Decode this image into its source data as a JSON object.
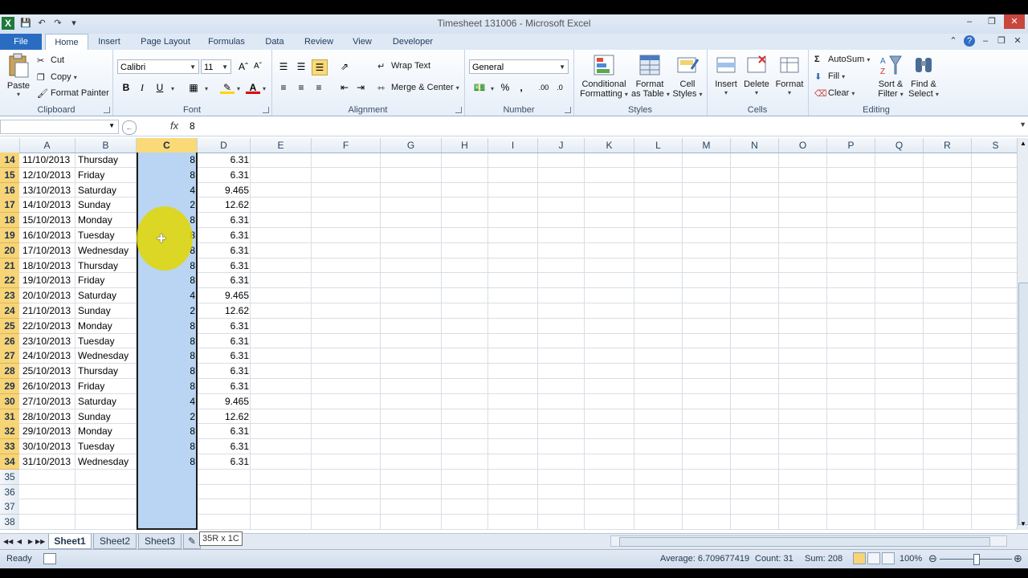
{
  "window": {
    "title": "Timesheet 131006 - Microsoft Excel"
  },
  "ribbon_tabs": [
    "File",
    "Home",
    "Insert",
    "Page Layout",
    "Formulas",
    "Data",
    "Review",
    "View",
    "Developer"
  ],
  "clipboard": {
    "paste": "Paste",
    "cut": "Cut",
    "copy": "Copy",
    "format_painter": "Format Painter",
    "label": "Clipboard"
  },
  "font": {
    "name": "Calibri",
    "size": "11",
    "bold": "B",
    "italic": "I",
    "underline": "U",
    "label": "Font"
  },
  "alignment": {
    "wrap_text": "Wrap Text",
    "merge_center": "Merge & Center",
    "label": "Alignment"
  },
  "number": {
    "format": "General",
    "percent": "%",
    "comma": ",",
    "label": "Number"
  },
  "styles": {
    "conditional_1": "Conditional",
    "conditional_2": "Formatting",
    "format_table_1": "Format",
    "format_table_2": "as Table",
    "cell_styles_1": "Cell",
    "cell_styles_2": "Styles",
    "label": "Styles"
  },
  "cells": {
    "insert": "Insert",
    "delete": "Delete",
    "format": "Format",
    "label": "Cells"
  },
  "editing": {
    "autosum": "AutoSum",
    "fill": "Fill",
    "clear": "Clear",
    "sort_1": "Sort &",
    "sort_2": "Filter",
    "find_1": "Find &",
    "find_2": "Select",
    "label": "Editing"
  },
  "formula_bar": {
    "name_box": "",
    "fx": "fx",
    "value": "8"
  },
  "columns": [
    "A",
    "B",
    "C",
    "D",
    "E",
    "F",
    "G",
    "H",
    "I",
    "J",
    "K",
    "L",
    "M",
    "N",
    "O",
    "P",
    "Q",
    "R",
    "S"
  ],
  "rows": [
    {
      "n": "14",
      "a": "11/10/2013",
      "b": "Thursday",
      "c": "8",
      "d": "6.31"
    },
    {
      "n": "15",
      "a": "12/10/2013",
      "b": "Friday",
      "c": "8",
      "d": "6.31"
    },
    {
      "n": "16",
      "a": "13/10/2013",
      "b": "Saturday",
      "c": "4",
      "d": "9.465"
    },
    {
      "n": "17",
      "a": "14/10/2013",
      "b": "Sunday",
      "c": "2",
      "d": "12.62"
    },
    {
      "n": "18",
      "a": "15/10/2013",
      "b": "Monday",
      "c": "8",
      "d": "6.31"
    },
    {
      "n": "19",
      "a": "16/10/2013",
      "b": "Tuesday",
      "c": "8",
      "d": "6.31"
    },
    {
      "n": "20",
      "a": "17/10/2013",
      "b": "Wednesday",
      "c": "8",
      "d": "6.31"
    },
    {
      "n": "21",
      "a": "18/10/2013",
      "b": "Thursday",
      "c": "8",
      "d": "6.31"
    },
    {
      "n": "22",
      "a": "19/10/2013",
      "b": "Friday",
      "c": "8",
      "d": "6.31"
    },
    {
      "n": "23",
      "a": "20/10/2013",
      "b": "Saturday",
      "c": "4",
      "d": "9.465"
    },
    {
      "n": "24",
      "a": "21/10/2013",
      "b": "Sunday",
      "c": "2",
      "d": "12.62"
    },
    {
      "n": "25",
      "a": "22/10/2013",
      "b": "Monday",
      "c": "8",
      "d": "6.31"
    },
    {
      "n": "26",
      "a": "23/10/2013",
      "b": "Tuesday",
      "c": "8",
      "d": "6.31"
    },
    {
      "n": "27",
      "a": "24/10/2013",
      "b": "Wednesday",
      "c": "8",
      "d": "6.31"
    },
    {
      "n": "28",
      "a": "25/10/2013",
      "b": "Thursday",
      "c": "8",
      "d": "6.31"
    },
    {
      "n": "29",
      "a": "26/10/2013",
      "b": "Friday",
      "c": "8",
      "d": "6.31"
    },
    {
      "n": "30",
      "a": "27/10/2013",
      "b": "Saturday",
      "c": "4",
      "d": "9.465"
    },
    {
      "n": "31",
      "a": "28/10/2013",
      "b": "Sunday",
      "c": "2",
      "d": "12.62"
    },
    {
      "n": "32",
      "a": "29/10/2013",
      "b": "Monday",
      "c": "8",
      "d": "6.31"
    },
    {
      "n": "33",
      "a": "30/10/2013",
      "b": "Tuesday",
      "c": "8",
      "d": "6.31"
    },
    {
      "n": "34",
      "a": "31/10/2013",
      "b": "Wednesday",
      "c": "8",
      "d": "6.31"
    },
    {
      "n": "35",
      "a": "",
      "b": "",
      "c": "",
      "d": ""
    },
    {
      "n": "36",
      "a": "",
      "b": "",
      "c": "",
      "d": ""
    },
    {
      "n": "37",
      "a": "",
      "b": "",
      "c": "",
      "d": ""
    },
    {
      "n": "38",
      "a": "",
      "b": "",
      "c": "",
      "d": ""
    }
  ],
  "sheets": [
    "Sheet1",
    "Sheet2",
    "Sheet3"
  ],
  "selection_tooltip": "35R x 1C",
  "status": {
    "ready": "Ready",
    "average": "Average: 6.709677419",
    "count": "Count: 31",
    "sum": "Sum: 208",
    "zoom": "100%"
  },
  "colors": {
    "selection": "#b9d5f3",
    "header_selected": "#f7d476",
    "file_tab": "#2a6cc1",
    "highlight": "#e2d600"
  }
}
